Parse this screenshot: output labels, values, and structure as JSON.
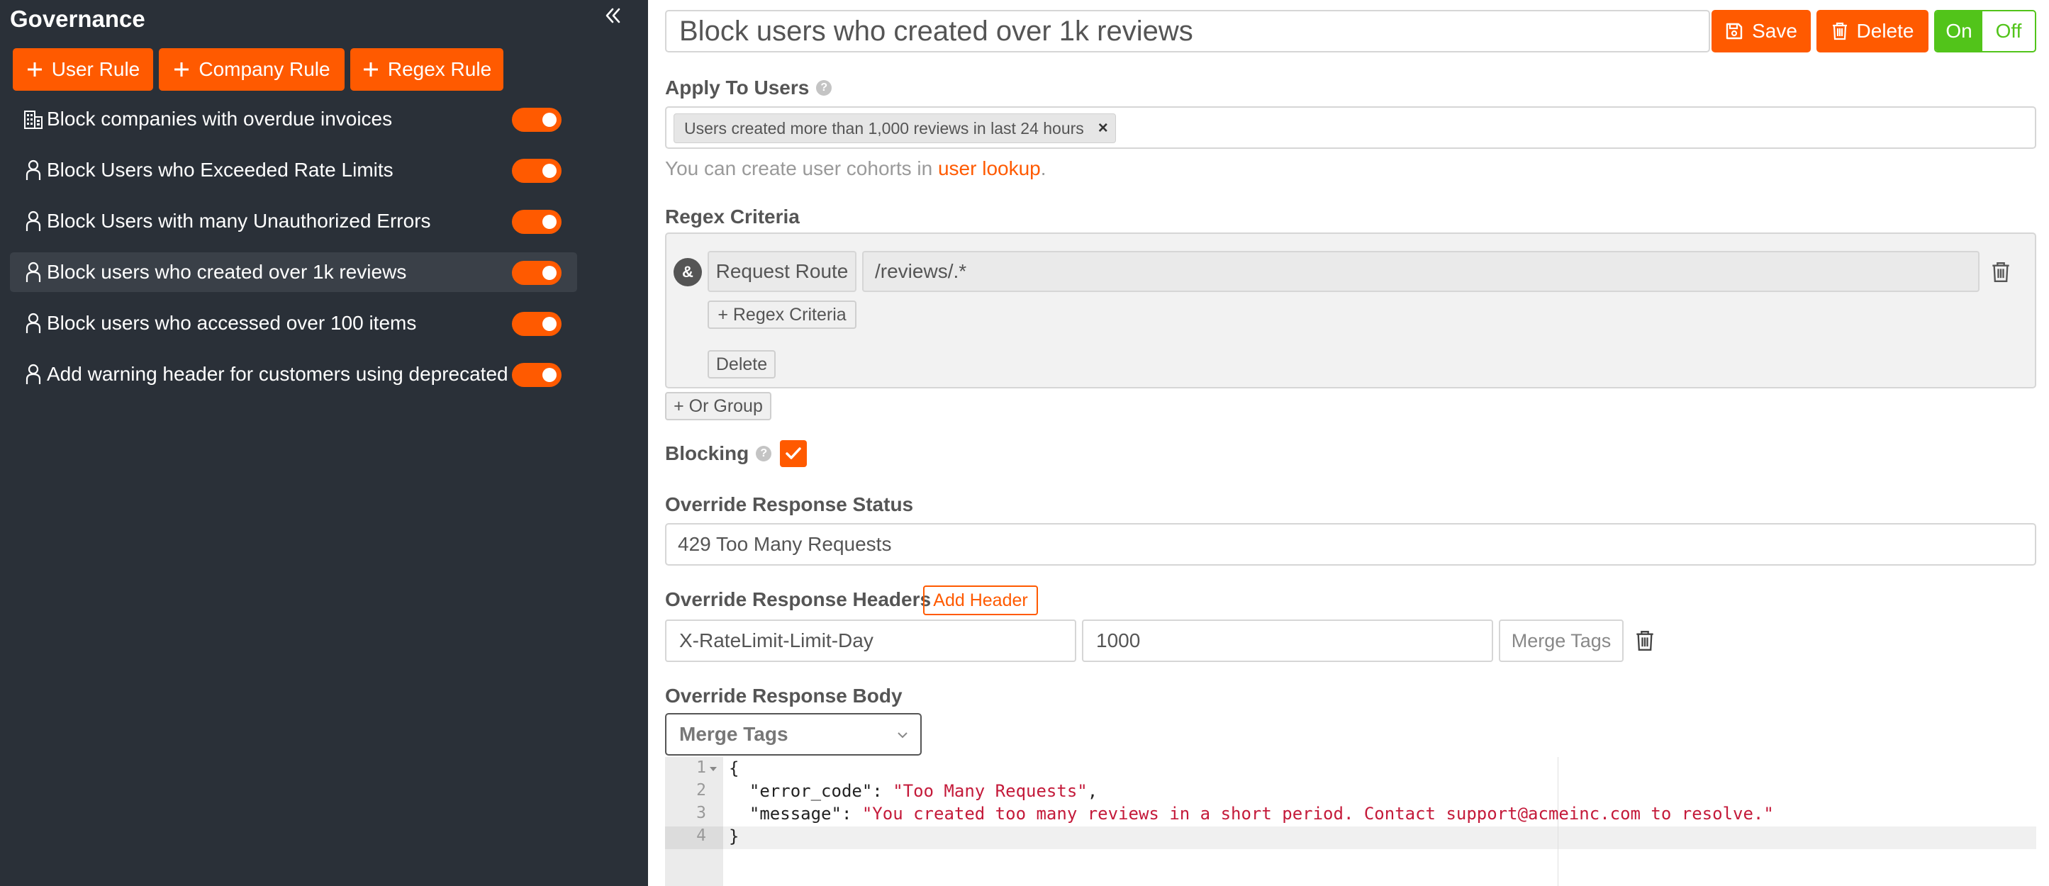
{
  "sidebar": {
    "title": "Governance",
    "add_buttons": [
      {
        "label": "User Rule"
      },
      {
        "label": "Company Rule"
      },
      {
        "label": "Regex Rule"
      }
    ],
    "rules": [
      {
        "label": "Block companies with overdue invoices",
        "icon": "building-icon",
        "enabled": true
      },
      {
        "label": "Block Users who Exceeded Rate Limits",
        "icon": "user-icon",
        "enabled": true
      },
      {
        "label": "Block Users with many Unauthorized Errors",
        "icon": "user-icon",
        "enabled": true
      },
      {
        "label": "Block users who created over 1k reviews",
        "icon": "user-icon",
        "enabled": true,
        "selected": true
      },
      {
        "label": "Block users who accessed over 100 items",
        "icon": "user-icon",
        "enabled": true
      },
      {
        "label": "Add warning header for customers using deprecated",
        "icon": "user-icon",
        "enabled": true
      }
    ]
  },
  "header": {
    "rule_name": "Block users who created over 1k reviews",
    "save_label": "Save",
    "delete_label": "Delete",
    "on_label": "On",
    "off_label": "Off"
  },
  "apply_to_users": {
    "label": "Apply To Users",
    "cohort_chip": "Users created more than 1,000 reviews in last 24 hours",
    "hint_prefix": "You can create user cohorts in ",
    "hint_link": "user lookup",
    "hint_suffix": "."
  },
  "regex_criteria": {
    "label": "Regex Criteria",
    "operator": "&",
    "field": "Request Route",
    "pattern": "/reviews/.*",
    "add_criteria_label": "+ Regex Criteria",
    "delete_label": "Delete",
    "or_group_label": "+ Or Group"
  },
  "blocking": {
    "label": "Blocking",
    "checked": true
  },
  "override_status": {
    "label": "Override Response Status",
    "value": "429 Too Many Requests"
  },
  "override_headers": {
    "label": "Override Response Headers",
    "add_header_label": "Add Header",
    "header_name": "X-RateLimit-Limit-Day",
    "header_value": "1000",
    "merge_tags_label": "Merge Tags"
  },
  "override_body": {
    "label": "Override Response Body",
    "merge_tags_select": "Merge Tags",
    "line_numbers": [
      "1",
      "2",
      "3",
      "4"
    ],
    "lines": {
      "l1": "{",
      "l2_key": "  \"error_code\": ",
      "l2_val": "\"Too Many Requests\"",
      "l2_end": ",",
      "l3_key": "  \"message\": ",
      "l3_val": "\"You created too many reviews in a short period. Contact support@acmeinc.com to resolve.\"",
      "l4": "}"
    }
  },
  "colors": {
    "accent": "#ff5a00",
    "on_green": "#52c41a",
    "sidebar_bg": "#2a3038"
  }
}
